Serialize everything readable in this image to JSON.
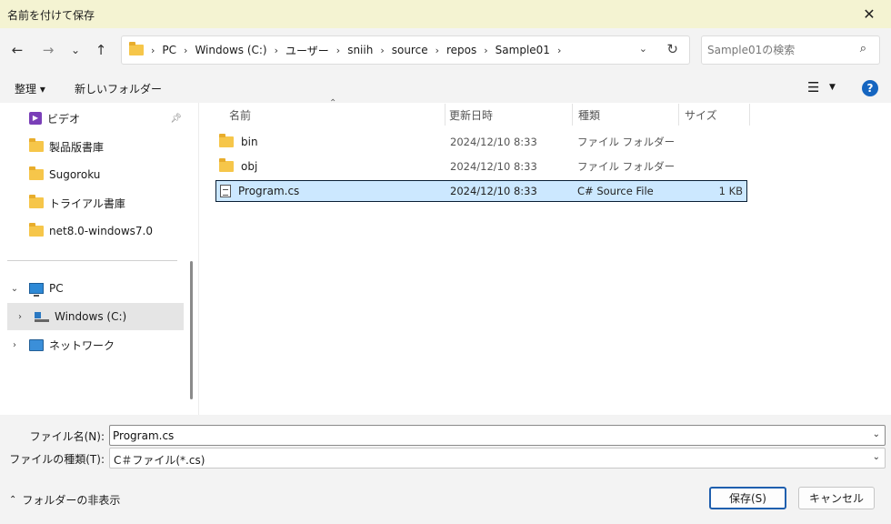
{
  "dialog": {
    "title": "名前を付けて保存",
    "close_glyph": "✕"
  },
  "nav": {
    "back": "←",
    "forward": "→",
    "recent": "⌄",
    "up": "↑",
    "breadcrumbs": [
      "PC",
      "Windows (C:)",
      "ユーザー",
      "sniih",
      "source",
      "repos",
      "Sample01"
    ],
    "search_placeholder": "Sample01の検索"
  },
  "toolbar": {
    "organize": "整理 ▾",
    "new_folder": "新しいフォルダー"
  },
  "sidebar": {
    "items": [
      {
        "label": "ビデオ",
        "icon": "video-icon",
        "pinned": true
      },
      {
        "label": "製品版書庫",
        "icon": "folder-icon"
      },
      {
        "label": "Sugoroku",
        "icon": "folder-icon"
      },
      {
        "label": "トライアル書庫",
        "icon": "folder-icon"
      },
      {
        "label": "net8.0-windows7.0",
        "icon": "folder-icon"
      },
      {
        "label": "PC",
        "icon": "pc-icon",
        "expanded": true
      },
      {
        "label": "Windows (C:)",
        "icon": "drive-icon",
        "selected": true
      },
      {
        "label": "ネットワーク",
        "icon": "network-icon"
      }
    ]
  },
  "file_list": {
    "columns": [
      "名前",
      "更新日時",
      "種類",
      "サイズ"
    ],
    "rows": [
      {
        "name": "bin",
        "modified": "2024/12/10 8:33",
        "type": "ファイル フォルダー",
        "size": "",
        "icon": "folder-icon"
      },
      {
        "name": "obj",
        "modified": "2024/12/10 8:33",
        "type": "ファイル フォルダー",
        "size": "",
        "icon": "folder-icon"
      },
      {
        "name": "Program.cs",
        "modified": "2024/12/10 8:33",
        "type": "C# Source File",
        "size": "1 KB",
        "icon": "document-icon",
        "selected": true
      }
    ]
  },
  "form": {
    "filename_label": "ファイル名(N):",
    "filename_value": "Program.cs",
    "filetype_label": "ファイルの種類(T):",
    "filetype_value": "C＃ファイル(*.cs)"
  },
  "footer": {
    "hide_folders": "フォルダーの非表示",
    "save": "保存(S)",
    "cancel": "キャンセル"
  },
  "colors": {
    "accent": "#1f5fae",
    "selection": "#cce8ff",
    "title_bg": "#f4f3d2",
    "folder": "#f6c64a"
  }
}
